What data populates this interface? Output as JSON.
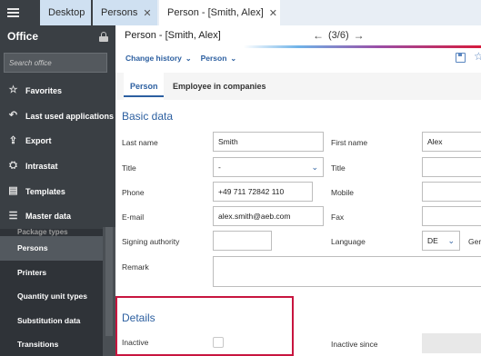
{
  "sidebar": {
    "title": "Office",
    "search_placeholder": "Search office",
    "items": [
      {
        "label": "Favorites",
        "icon": "star-icon"
      },
      {
        "label": "Last used applications",
        "icon": "history-icon"
      },
      {
        "label": "Export",
        "icon": "export-icon"
      },
      {
        "label": "Intrastat",
        "icon": "intrastat-icon"
      },
      {
        "label": "Templates",
        "icon": "templates-icon"
      },
      {
        "label": "Master data",
        "icon": "database-icon"
      }
    ],
    "sub_items": [
      {
        "label": "Package types"
      },
      {
        "label": "Persons"
      },
      {
        "label": "Printers"
      },
      {
        "label": "Quantity unit types"
      },
      {
        "label": "Substitution data"
      },
      {
        "label": "Transitions"
      }
    ]
  },
  "tabs": [
    {
      "label": "Desktop"
    },
    {
      "label": "Persons"
    },
    {
      "label": "Person - [Smith, Alex]"
    }
  ],
  "record": {
    "title": "Person - [Smith, Alex]",
    "position": "(3/6)"
  },
  "actions": {
    "change_history": "Change history",
    "person": "Person"
  },
  "subtabs": {
    "person": "Person",
    "employee": "Employee in companies"
  },
  "basic_data": {
    "title": "Basic data",
    "last_name_label": "Last name",
    "last_name": "Smith",
    "first_name_label": "First name",
    "first_name": "Alex",
    "title_label": "Title",
    "title_value": "-",
    "title2_label": "Title",
    "phone_label": "Phone",
    "phone": "+49 711 72842 110",
    "mobile_label": "Mobile",
    "email_label": "E-mail",
    "email": "alex.smith@aeb.com",
    "fax_label": "Fax",
    "signing_label": "Signing authority",
    "language_label": "Language",
    "language": "DE",
    "language_suffix": "Ger",
    "remark_label": "Remark"
  },
  "details": {
    "title": "Details",
    "inactive_label": "Inactive",
    "inactive_since_label": "Inactive since"
  },
  "colors": {
    "accent": "#2c5fa0",
    "sidebar": "#3a3f44",
    "highlight": "#c8153f"
  }
}
